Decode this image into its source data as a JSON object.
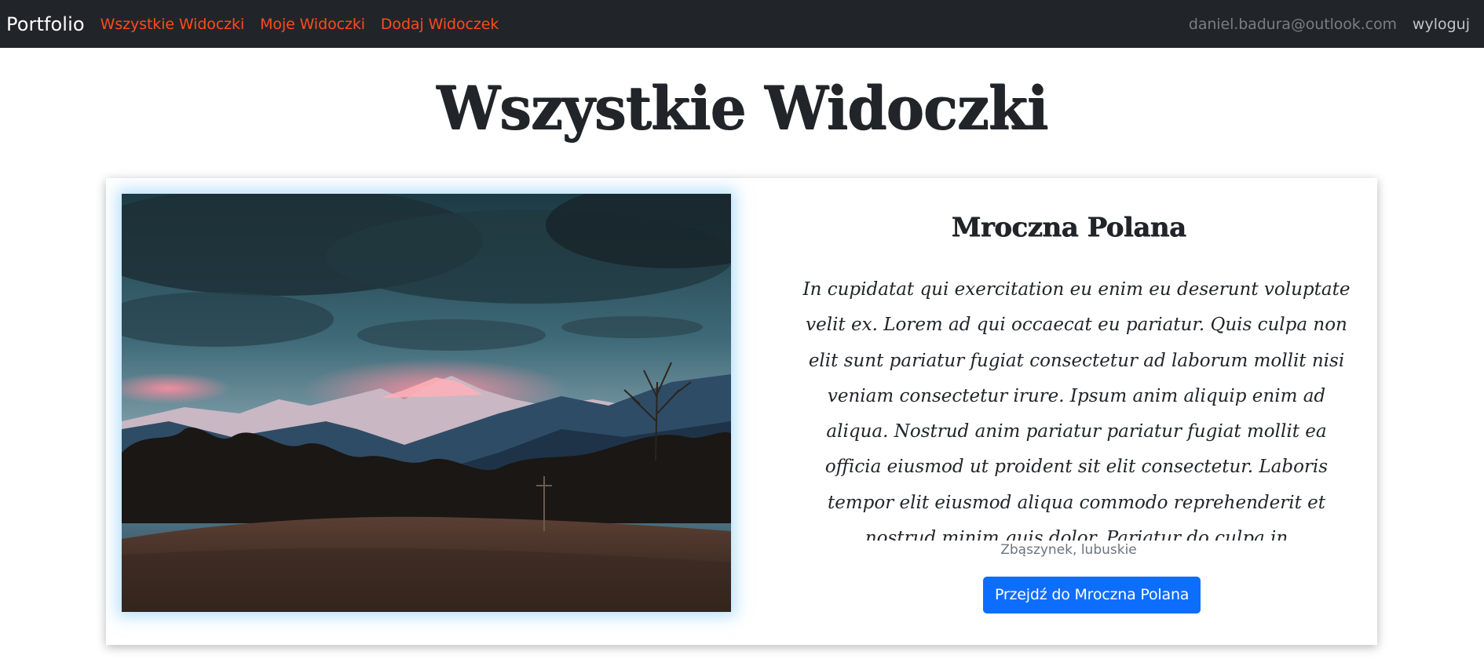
{
  "navbar": {
    "brand": "Portfolio",
    "links": [
      {
        "label": "Wszystkie Widoczki"
      },
      {
        "label": "Moje Widoczki"
      },
      {
        "label": "Dodaj Widoczek"
      }
    ],
    "user_email": "daniel.badura@outlook.com",
    "logout_label": "wyloguj"
  },
  "page": {
    "title": "Wszystkie Widoczki"
  },
  "cards": [
    {
      "title": "Mroczna Polana",
      "description": "In cupidatat qui exercitation eu enim eu deserunt voluptate velit ex. Lorem ad qui occaecat eu pariatur. Quis culpa non elit sunt pariatur fugiat consectetur ad laborum mollit nisi veniam consectetur irure. Ipsum anim aliquip enim ad aliqua. Nostrud anim pariatur pariatur fugiat mollit ea officia eiusmod ut proident sit elit consectetur. Laboris tempor elit eiusmod aliqua commodo reprehenderit et nostrud minim quis dolor. Pariatur do culpa in",
      "location": "Zbąszynek, lubuskie",
      "button_label": "Przejdź do Mroczna Polana",
      "image_icon": "landscape-photo"
    }
  ],
  "colors": {
    "navbar_bg": "#212529",
    "nav_link": "#ff4a1c",
    "primary_button": "#0d6efd",
    "muted_text": "#6c757d"
  }
}
